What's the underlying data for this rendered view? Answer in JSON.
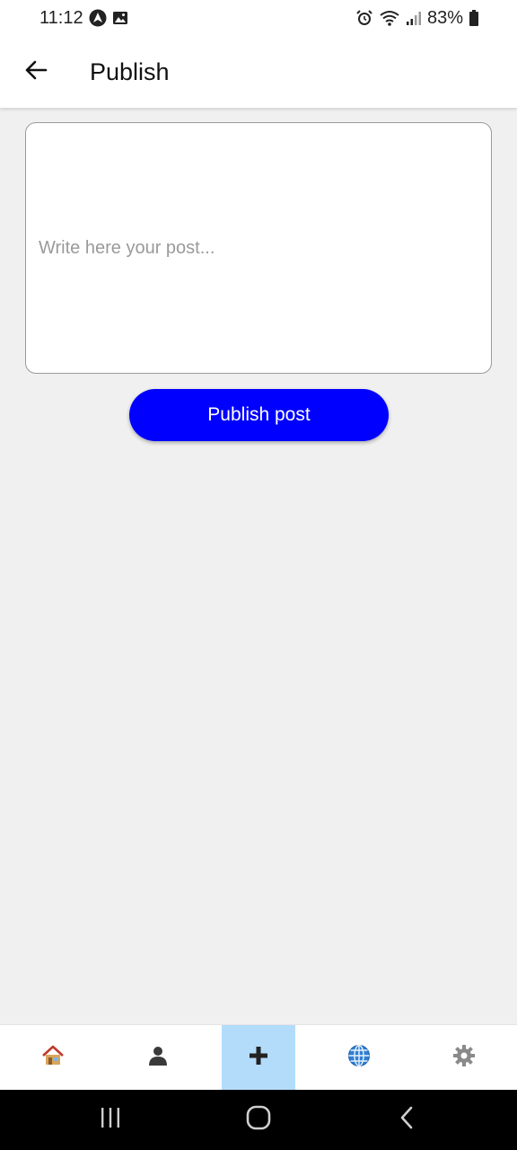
{
  "status_bar": {
    "time": "11:12",
    "battery": "83%",
    "left_icons": [
      "navigation-app-icon",
      "image-icon"
    ],
    "right_icons": [
      "alarm-icon",
      "wifi-icon",
      "signal-icon",
      "battery-icon"
    ]
  },
  "header": {
    "title": "Publish",
    "back_icon": "arrow-left-icon"
  },
  "post_form": {
    "placeholder": "Write here your post...",
    "value": "",
    "publish_label": "Publish post"
  },
  "bottom_nav": {
    "items": [
      {
        "icon": "home-icon",
        "active": false
      },
      {
        "icon": "profile-icon",
        "active": false
      },
      {
        "icon": "plus-icon",
        "active": true
      },
      {
        "icon": "globe-icon",
        "active": false
      },
      {
        "icon": "settings-icon",
        "active": false
      }
    ]
  },
  "system_nav": {
    "buttons": [
      "recent-apps-icon",
      "home-circle-icon",
      "back-chevron-icon"
    ]
  },
  "colors": {
    "primary_button": "#0000ff",
    "active_tab": "#b3dcfb",
    "background": "#f0f0f0"
  }
}
